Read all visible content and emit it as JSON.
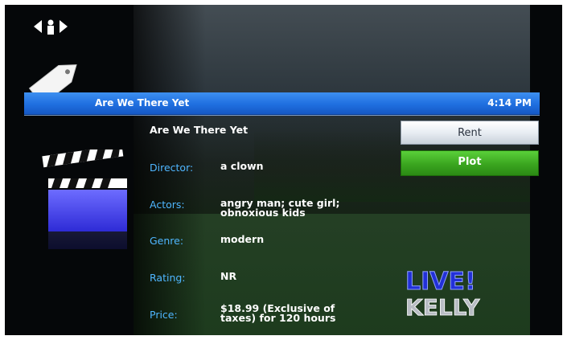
{
  "header": {
    "title": "Are We There Yet",
    "time": "4:14 PM"
  },
  "movie": {
    "title": "Are We There Yet",
    "fields": {
      "director": {
        "label": "Director:",
        "value": "a clown"
      },
      "actors": {
        "label": "Actors:",
        "value": "angry man; cute girl; obnoxious kids"
      },
      "genre": {
        "label": "Genre:",
        "value": "modern"
      },
      "rating": {
        "label": "Rating:",
        "value": "NR"
      },
      "price": {
        "label": "Price:",
        "value": "$18.99 (Exclusive of taxes) for 120 hours"
      }
    }
  },
  "buttons": {
    "rent": "Rent",
    "plot": "Plot"
  },
  "logo": {
    "line1": "LIVE!",
    "line2": "KELLY"
  },
  "icons": [
    "nav-arrows-icon",
    "tag-icon",
    "clapperboard-icon"
  ],
  "colors": {
    "header_blue": "#1f6fe0",
    "label_blue": "#4fb6ff",
    "plot_green": "#3aa51f"
  }
}
